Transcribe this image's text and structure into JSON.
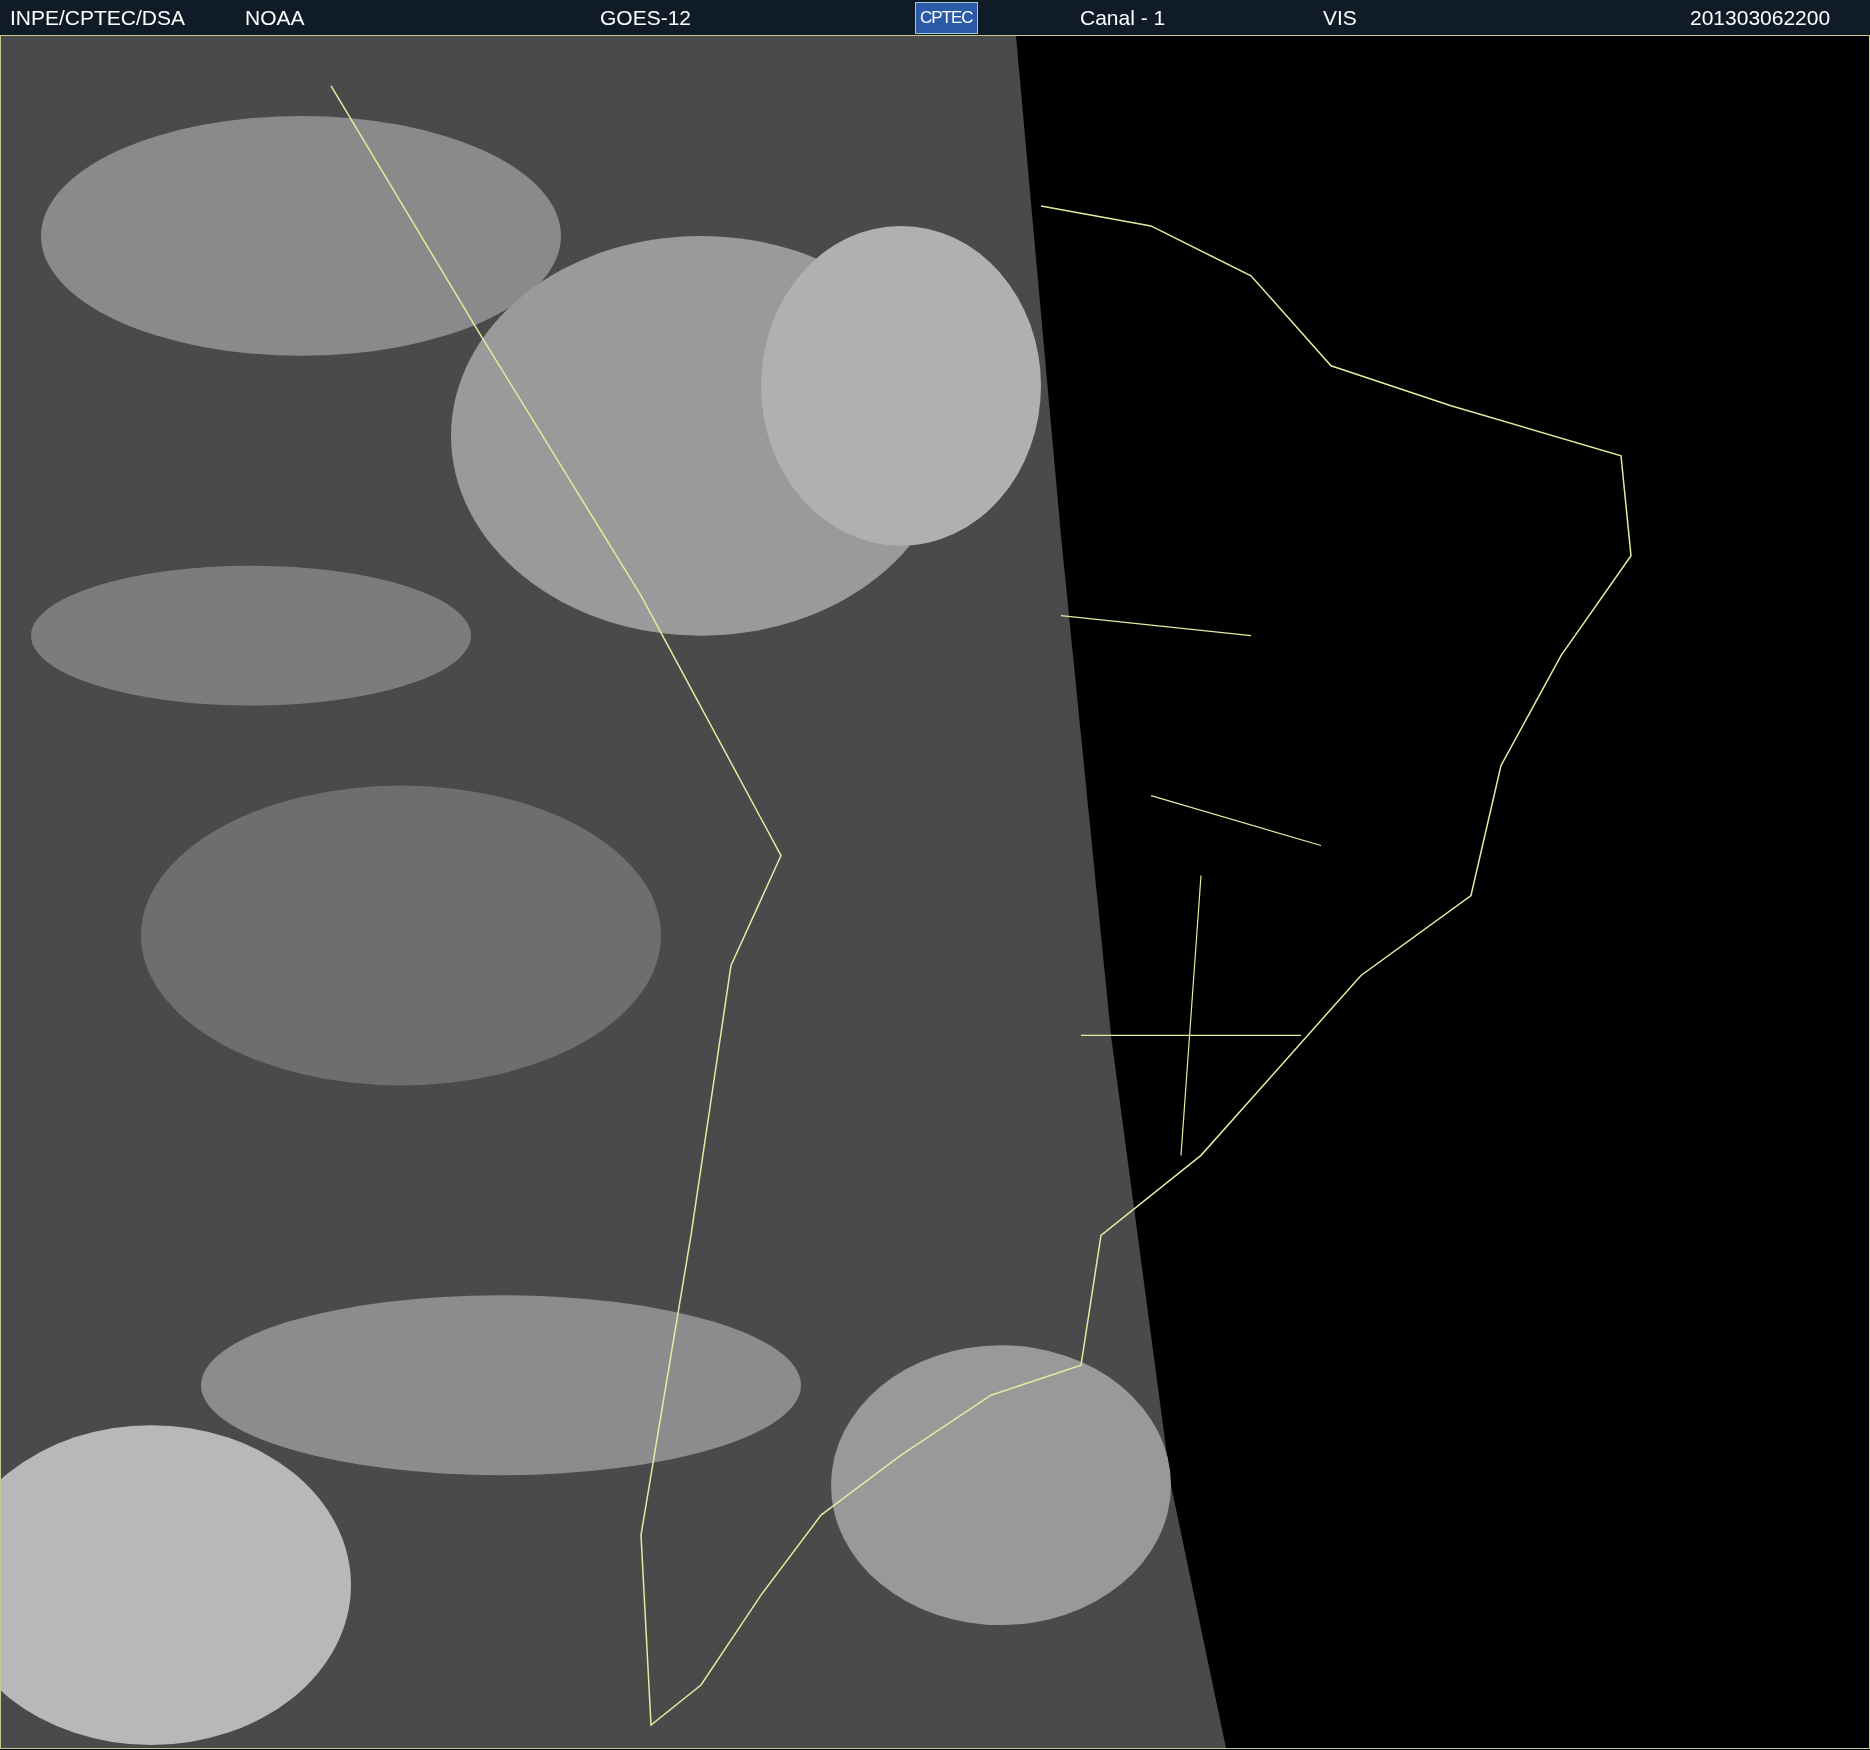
{
  "header": {
    "items": [
      {
        "kind": "text",
        "text": "INPE/CPTEC/DSA"
      },
      {
        "kind": "text",
        "text": "NOAA"
      },
      {
        "kind": "text",
        "text": "GOES-12"
      },
      {
        "kind": "logo",
        "text": "CPTEC"
      },
      {
        "kind": "text",
        "text": "Canal - 1"
      },
      {
        "kind": "text",
        "text": "VIS"
      },
      {
        "kind": "text",
        "text": "201303062200"
      }
    ]
  }
}
